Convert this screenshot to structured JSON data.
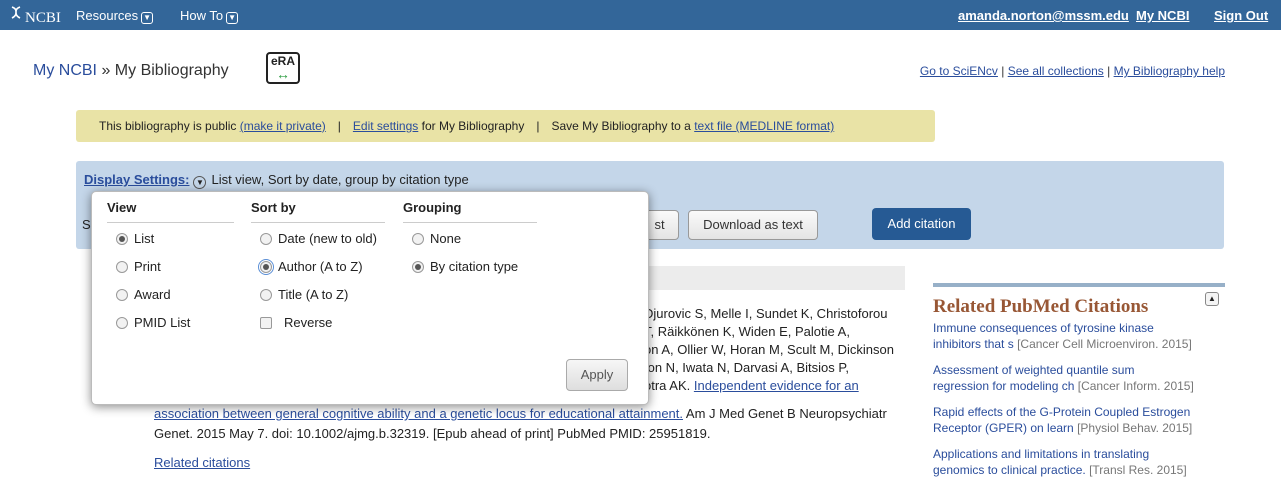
{
  "topbar": {
    "logo": "NCBI",
    "resources": "Resources",
    "howto": "How To",
    "user_email": "amanda.norton@mssm.edu",
    "my_ncbi": "My NCBI",
    "sign_out": "Sign Out"
  },
  "header": {
    "crumb_root": "My NCBI",
    "crumb_sep": " » ",
    "crumb_page": "My Bibliography",
    "era_label": "eRA",
    "link_scienCV": "Go to SciENcv",
    "link_collections": "See all collections",
    "link_help": "My Bibliography help",
    "sep": " | "
  },
  "publicbar": {
    "public_text": "This bibliography is public ",
    "make_private": "(make it private)",
    "sep": "|",
    "edit_settings": "Edit settings",
    "edit_suffix": " for My Bibliography",
    "save_prefix": "Save My Bibliography to a ",
    "save_link": "text file (MEDLINE format)"
  },
  "settings": {
    "label": "Display Settings:",
    "summary": "List view, Sort by date, group by citation type",
    "partial_left": "S",
    "partial_button": "st",
    "download": "Download as text",
    "add_citation": "Add citation"
  },
  "popup": {
    "view": {
      "title": "View",
      "options": [
        "List",
        "Print",
        "Award",
        "PMID List"
      ],
      "selected": 0
    },
    "sort": {
      "title": "Sort by",
      "options": [
        "Date (new to old)",
        "Author (A to Z)",
        "Title (A to Z)"
      ],
      "selected": 1,
      "reverse": "Reverse"
    },
    "group": {
      "title": "Grouping",
      "options": [
        "None",
        "By citation type"
      ],
      "selected": 1
    },
    "apply": "Apply"
  },
  "citation": {
    "line1": "Djurovic S, Melle I, Sundet K, Christoforou",
    "line2": "T, Räikkönen K, Widen E, Palotie A,",
    "line3": "on A, Ollier W, Horan M, Scult M, Dickinson",
    "line4": "ton N, Iwata N, Darvasi A, Bitsios P,",
    "line5_prefix": "otra AK. ",
    "line5_link": "Independent evidence for an",
    "line6_link": "association between general cognitive ability and a genetic locus for educational attainment.",
    "line6_rest": " Am J Med Genet B Neuropsychiatr",
    "line7": "Genet. 2015 May 7. doi: 10.1002/ajmg.b.32319. [Epub ahead of print] PubMed PMID: 25951819.",
    "related": "Related citations"
  },
  "sidebar": {
    "title": "Related PubMed Citations",
    "items": [
      {
        "l1": "Immune consequences of tyrosine kinase",
        "l2": "inhibitors that s",
        "src": "[Cancer Cell Microenviron. 2015]"
      },
      {
        "l1": "Assessment of weighted quantile sum",
        "l2": "regression for modeling ch",
        "src": "[Cancer Inform. 2015]"
      },
      {
        "l1": "Rapid effects of the G-Protein Coupled Estrogen",
        "l2": "Receptor (GPER) on learn",
        "src": "[Physiol Behav. 2015]"
      },
      {
        "l1": "Applications and limitations in translating",
        "l2": "genomics to clinical practice.",
        "src": "[Transl Res. 2015]"
      }
    ]
  },
  "colors": {
    "topbar": "#336699",
    "yellowbar": "#e9e3a6",
    "settingsbar": "#c4d6e9",
    "primary_button": "#265a94",
    "sidebar_title": "#985735"
  }
}
